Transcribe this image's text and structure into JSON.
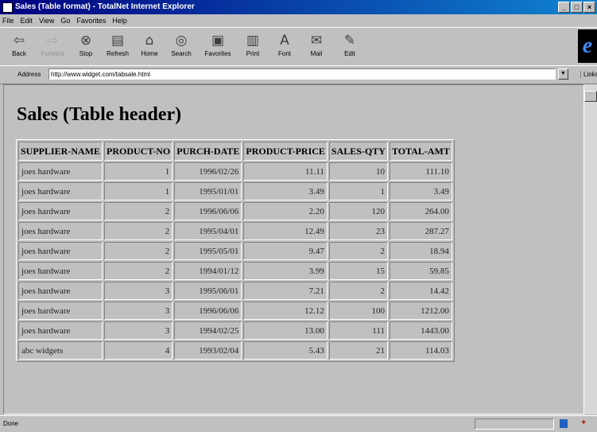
{
  "window": {
    "title": "Sales (Table format) - TotalNet Internet Explorer"
  },
  "menu": [
    "File",
    "Edit",
    "View",
    "Go",
    "Favorites",
    "Help"
  ],
  "toolbar": [
    {
      "label": "Back",
      "icon": "back-arrow-icon",
      "glyph": "⇦",
      "enabled": true
    },
    {
      "label": "Forward",
      "icon": "forward-arrow-icon",
      "glyph": "⇨",
      "enabled": false
    },
    {
      "label": "Stop",
      "icon": "stop-icon",
      "glyph": "⊗",
      "enabled": true
    },
    {
      "label": "Refresh",
      "icon": "refresh-icon",
      "glyph": "▤",
      "enabled": true
    },
    {
      "label": "Home",
      "icon": "home-icon",
      "glyph": "⌂",
      "enabled": true
    },
    {
      "label": "Search",
      "icon": "search-icon",
      "glyph": "◎",
      "enabled": true
    },
    {
      "label": "Favorites",
      "icon": "favorites-icon",
      "glyph": "▣",
      "enabled": true
    },
    {
      "label": "Print",
      "icon": "print-icon",
      "glyph": "▥",
      "enabled": true
    },
    {
      "label": "Font",
      "icon": "font-icon",
      "glyph": "A",
      "enabled": true
    },
    {
      "label": "Mail",
      "icon": "mail-icon",
      "glyph": "✉",
      "enabled": true
    },
    {
      "label": "Edit",
      "icon": "edit-icon",
      "glyph": "✎",
      "enabled": true
    }
  ],
  "address": {
    "label": "Address",
    "url": "http://www.widget.com/tabsale.html"
  },
  "links_label": "Links",
  "page": {
    "heading": "Sales (Table header)",
    "table": {
      "headers": [
        "SUPPLIER-NAME",
        "PRODUCT-NO",
        "PURCH-DATE",
        "PRODUCT-PRICE",
        "SALES-QTY",
        "TOTAL-AMT"
      ],
      "rows": [
        [
          "joes hardware",
          "1",
          "1996/02/26",
          "11.11",
          "10",
          "111.10"
        ],
        [
          "joes hardware",
          "1",
          "1995/01/01",
          "3.49",
          "1",
          "3.49"
        ],
        [
          "joes hardware",
          "2",
          "1996/06/06",
          "2.20",
          "120",
          "264.00"
        ],
        [
          "joes hardware",
          "2",
          "1995/04/01",
          "12.49",
          "23",
          "287.27"
        ],
        [
          "joes hardware",
          "2",
          "1995/05/01",
          "9.47",
          "2",
          "18.94"
        ],
        [
          "joes hardware",
          "2",
          "1994/01/12",
          "3.99",
          "15",
          "59.85"
        ],
        [
          "joes hardware",
          "3",
          "1995/06/01",
          "7.21",
          "2",
          "14.42"
        ],
        [
          "joes hardware",
          "3",
          "1996/06/06",
          "12.12",
          "100",
          "1212.00"
        ],
        [
          "joes hardware",
          "3",
          "1994/02/25",
          "13.00",
          "111",
          "1443.00"
        ],
        [
          "abc widgets",
          "4",
          "1993/02/04",
          "5.43",
          "21",
          "114.03"
        ]
      ]
    }
  },
  "status": {
    "text": "Done"
  }
}
